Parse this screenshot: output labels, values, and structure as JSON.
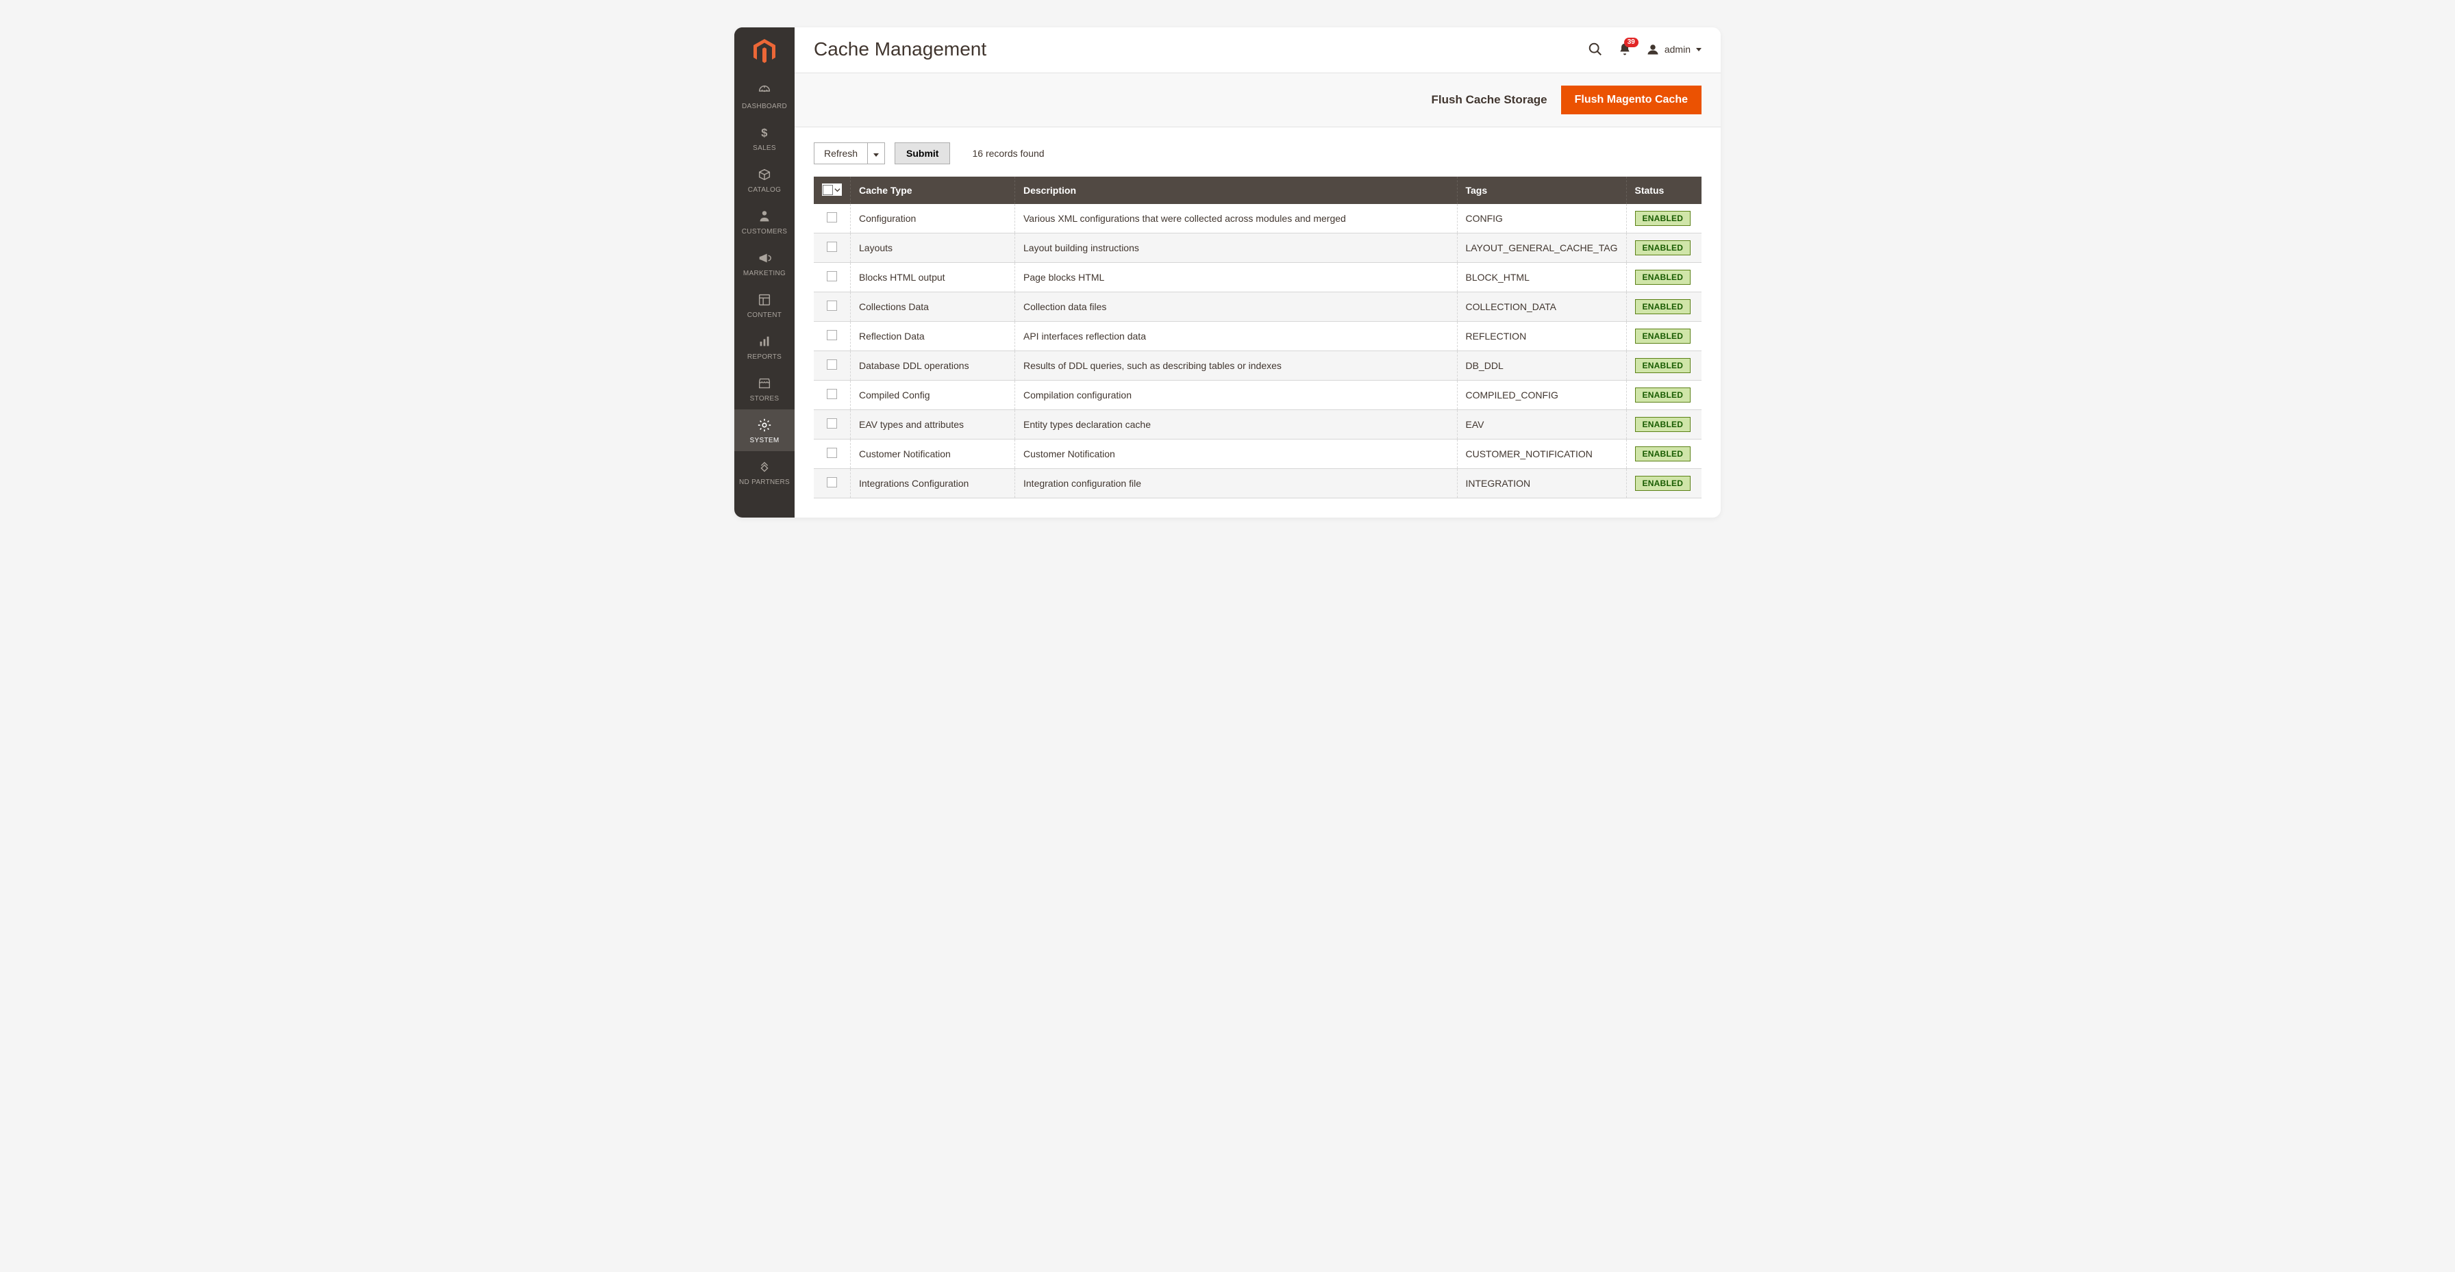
{
  "sidebar": {
    "items": [
      {
        "label": "DASHBOARD",
        "icon": "dashboard"
      },
      {
        "label": "SALES",
        "icon": "dollar"
      },
      {
        "label": "CATALOG",
        "icon": "box"
      },
      {
        "label": "CUSTOMERS",
        "icon": "person"
      },
      {
        "label": "MARKETING",
        "icon": "megaphone"
      },
      {
        "label": "CONTENT",
        "icon": "layout"
      },
      {
        "label": "REPORTS",
        "icon": "chart"
      },
      {
        "label": "STORES",
        "icon": "storefront"
      },
      {
        "label": "SYSTEM",
        "icon": "gear",
        "active": true
      },
      {
        "label": "ND PARTNERS",
        "icon": "partners"
      }
    ]
  },
  "header": {
    "title": "Cache Management",
    "notification_count": "39",
    "user_label": "admin"
  },
  "actions": {
    "flush_storage": "Flush Cache Storage",
    "flush_magento": "Flush Magento Cache"
  },
  "toolbar": {
    "refresh": "Refresh",
    "submit": "Submit",
    "records_found": "16 records found"
  },
  "table": {
    "columns": {
      "type": "Cache Type",
      "description": "Description",
      "tags": "Tags",
      "status": "Status"
    },
    "status_label": "ENABLED",
    "rows": [
      {
        "type": "Configuration",
        "description": "Various XML configurations that were collected across modules and merged",
        "tags": "CONFIG"
      },
      {
        "type": "Layouts",
        "description": "Layout building instructions",
        "tags": "LAYOUT_GENERAL_CACHE_TAG"
      },
      {
        "type": "Blocks HTML output",
        "description": "Page blocks HTML",
        "tags": "BLOCK_HTML"
      },
      {
        "type": "Collections Data",
        "description": "Collection data files",
        "tags": "COLLECTION_DATA"
      },
      {
        "type": "Reflection Data",
        "description": "API interfaces reflection data",
        "tags": "REFLECTION"
      },
      {
        "type": "Database DDL operations",
        "description": "Results of DDL queries, such as describing tables or indexes",
        "tags": "DB_DDL"
      },
      {
        "type": "Compiled Config",
        "description": "Compilation configuration",
        "tags": "COMPILED_CONFIG"
      },
      {
        "type": "EAV types and attributes",
        "description": "Entity types declaration cache",
        "tags": "EAV"
      },
      {
        "type": "Customer Notification",
        "description": "Customer Notification",
        "tags": "CUSTOMER_NOTIFICATION"
      },
      {
        "type": "Integrations Configuration",
        "description": "Integration configuration file",
        "tags": "INTEGRATION"
      }
    ]
  }
}
